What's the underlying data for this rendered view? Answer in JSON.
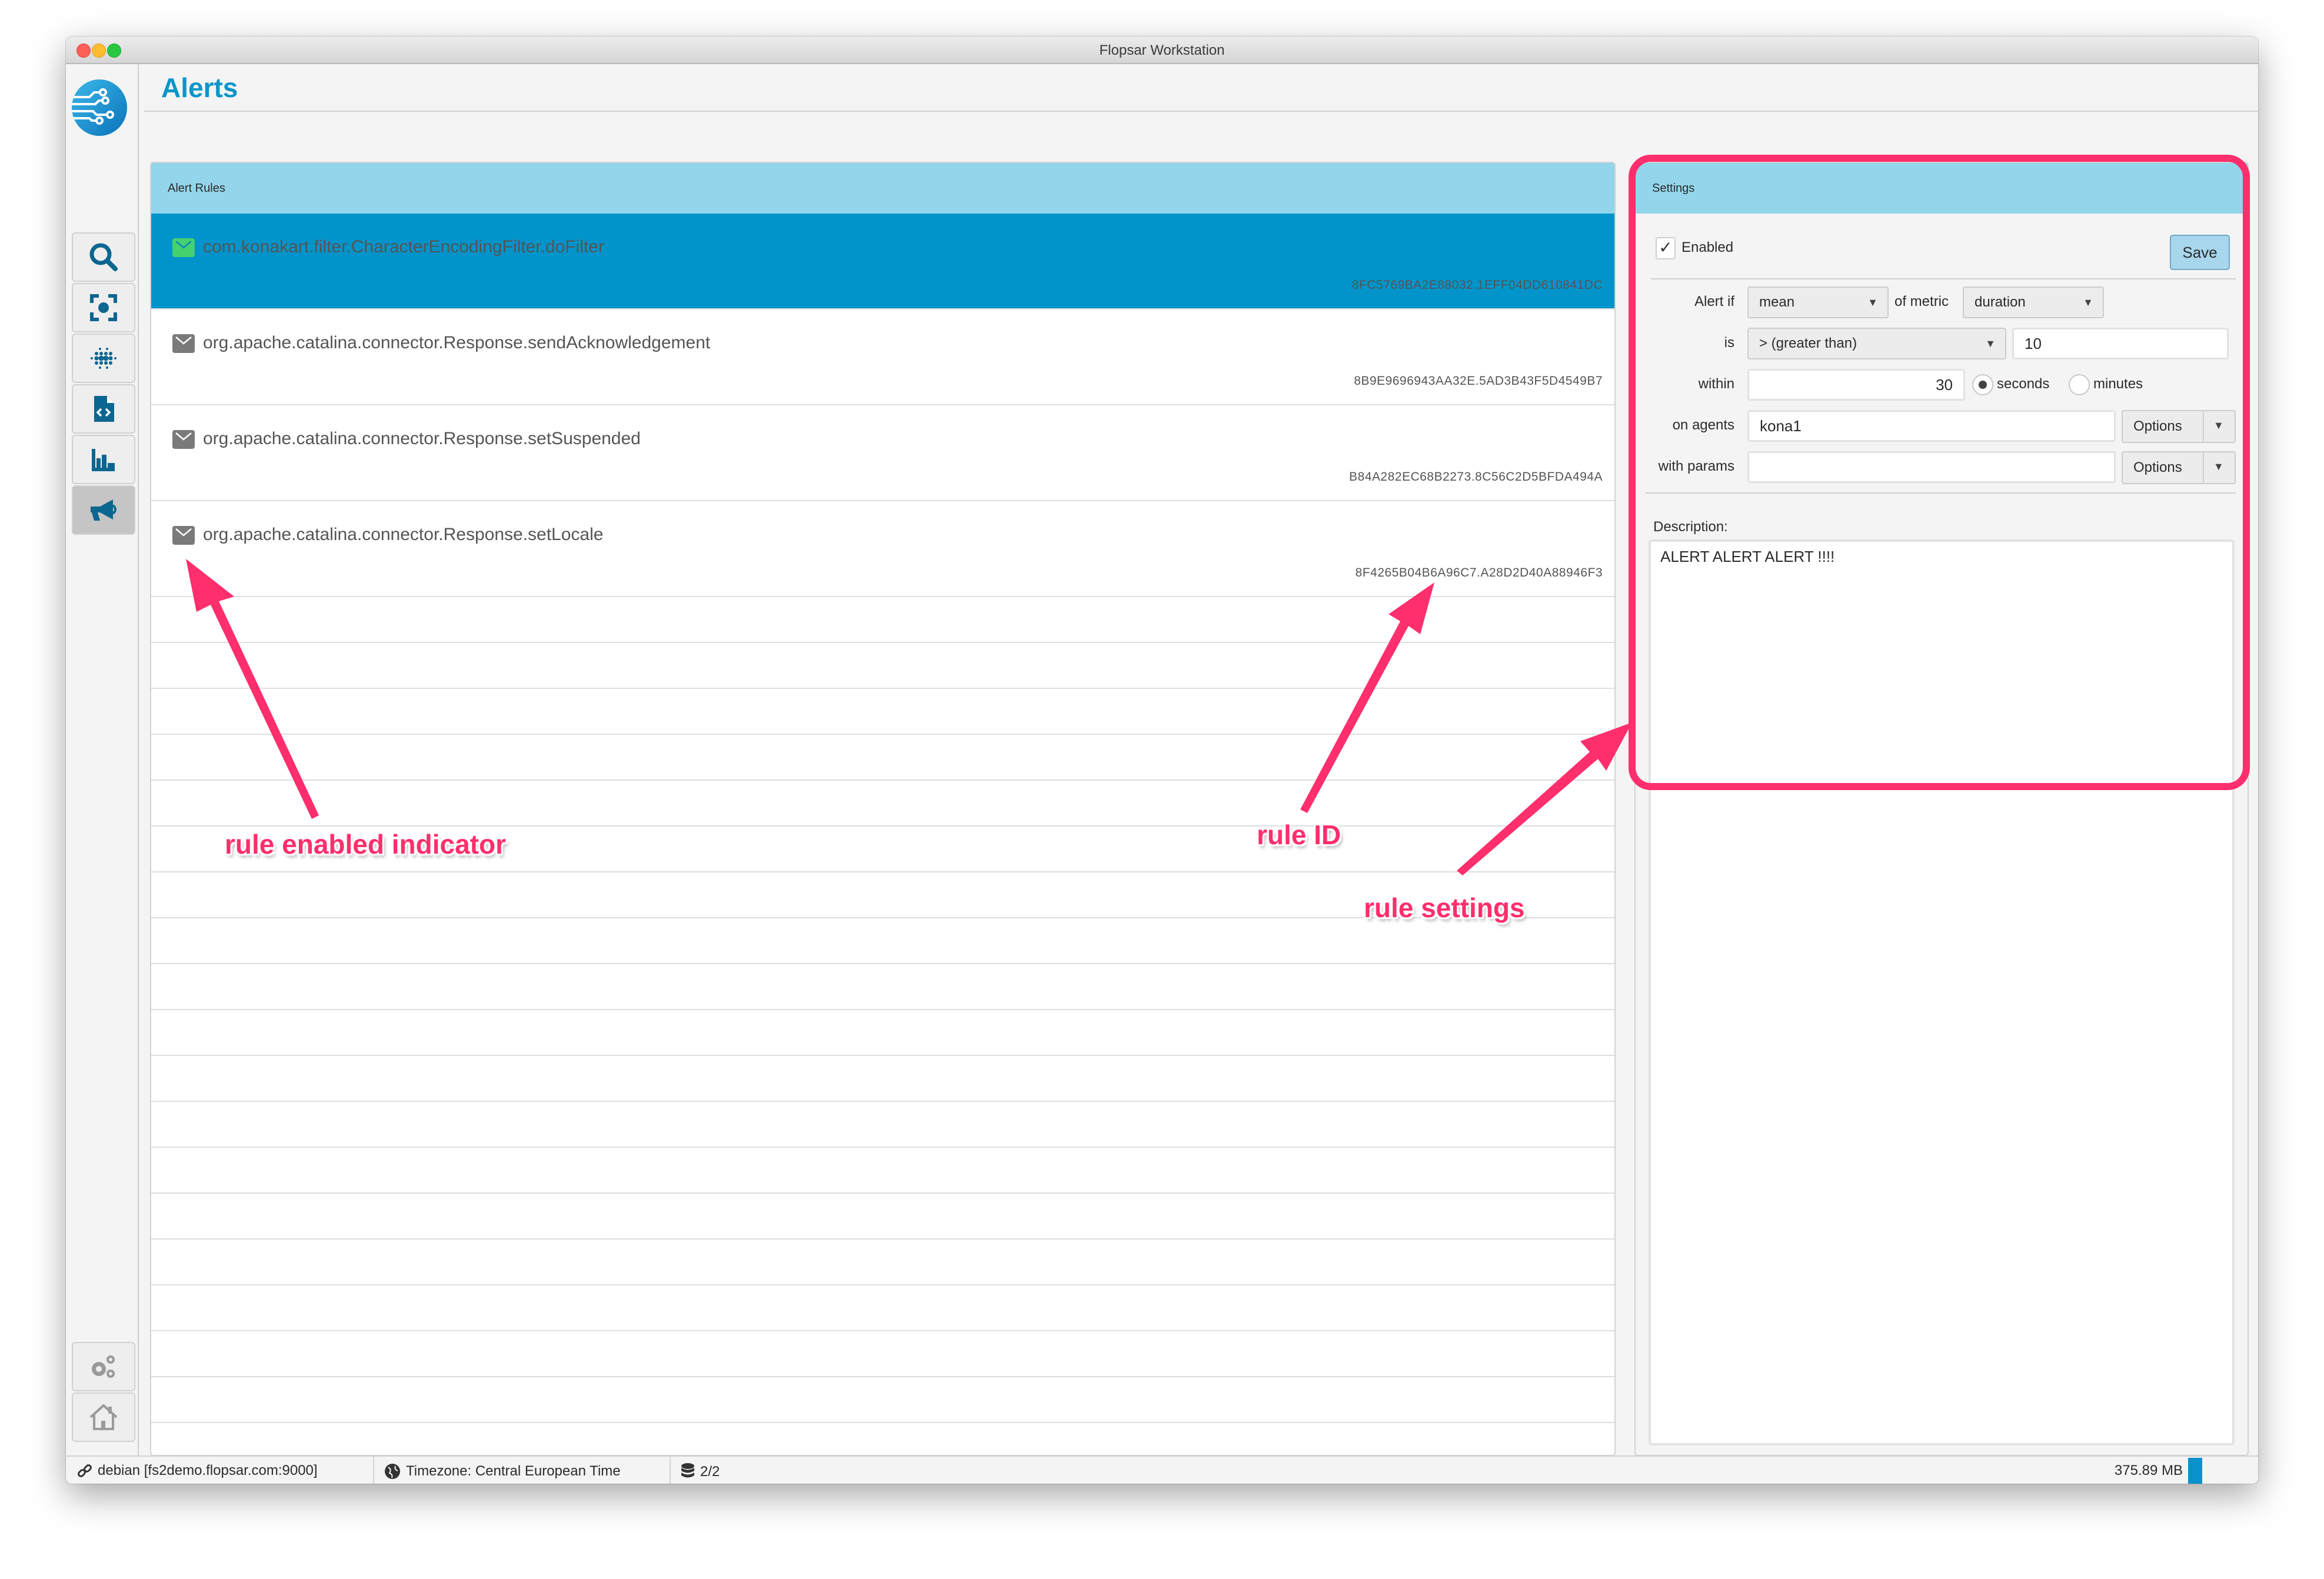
{
  "window": {
    "title": "Flopsar Workstation"
  },
  "header": {
    "title": "Alerts"
  },
  "sidebar": {
    "items": [
      {
        "name": "search",
        "icon": "search-icon",
        "active": false
      },
      {
        "name": "focus",
        "icon": "focus-target-icon",
        "active": false
      },
      {
        "name": "dots",
        "icon": "dot-matrix-icon",
        "active": false
      },
      {
        "name": "code-file",
        "icon": "code-file-icon",
        "active": false
      },
      {
        "name": "charts",
        "icon": "bar-chart-icon",
        "active": false
      },
      {
        "name": "alerts",
        "icon": "megaphone-icon",
        "active": true
      }
    ],
    "bottom_items": [
      {
        "name": "settings",
        "icon": "gears-icon"
      },
      {
        "name": "home",
        "icon": "home-icon"
      }
    ]
  },
  "rules_panel": {
    "title": "Alert Rules",
    "rules": [
      {
        "name": "com.konakart.filter.CharacterEncodingFilter.doFilter",
        "id": "8FC5769BA2E88032.1EFF04DD610841DC",
        "enabled": true,
        "selected": true
      },
      {
        "name": "org.apache.catalina.connector.Response.sendAcknowledgement",
        "id": "8B9E9696943AA32E.5AD3B43F5D4549B7",
        "enabled": false,
        "selected": false
      },
      {
        "name": "org.apache.catalina.connector.Response.setSuspended",
        "id": "B84A282EC68B2273.8C56C2D5BFDA494A",
        "enabled": false,
        "selected": false
      },
      {
        "name": "org.apache.catalina.connector.Response.setLocale",
        "id": "8F4265B04B6A96C7.A28D2D40A88946F3",
        "enabled": false,
        "selected": false
      }
    ]
  },
  "settings": {
    "title": "Settings",
    "enabled_label": "Enabled",
    "enabled": true,
    "save_label": "Save",
    "alert_if_label": "Alert if",
    "aggregate": "mean",
    "of_metric_label": "of metric",
    "metric": "duration",
    "is_label": "is",
    "operator": "> (greater than)",
    "threshold": "10",
    "within_label": "within",
    "window_value": "30",
    "unit_seconds": "seconds",
    "unit_minutes": "minutes",
    "selected_unit": "seconds",
    "on_agents_label": "on agents",
    "agents": "kona1",
    "with_params_label": "with params",
    "params": "",
    "options_label": "Options",
    "description_label": "Description:",
    "description": "ALERT ALERT ALERT !!!!"
  },
  "statusbar": {
    "connection": "debian [fs2demo.flopsar.com:9000]",
    "timezone": "Timezone: Central European Time",
    "databases": "2/2",
    "memory": "375.89 MB"
  },
  "annotations": {
    "indicator": "rule enabled indicator",
    "rule_id": "rule ID",
    "rule_settings": "rule settings",
    "color": "#ff2e6c"
  }
}
